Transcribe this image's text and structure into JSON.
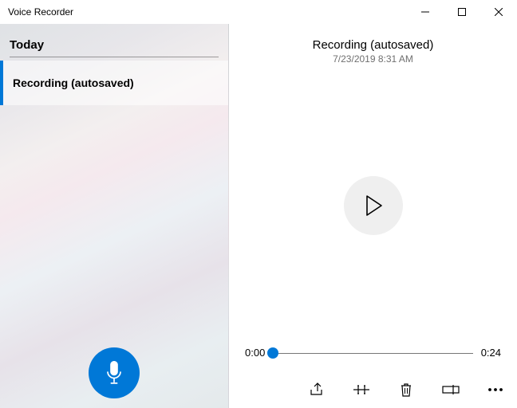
{
  "window": {
    "title": "Voice Recorder"
  },
  "sidebar": {
    "section": "Today",
    "items": [
      {
        "label": "Recording (autosaved)"
      }
    ]
  },
  "detail": {
    "title": "Recording (autosaved)",
    "datetime": "7/23/2019 8:31 AM",
    "current_time": "0:00",
    "total_time": "0:24"
  }
}
